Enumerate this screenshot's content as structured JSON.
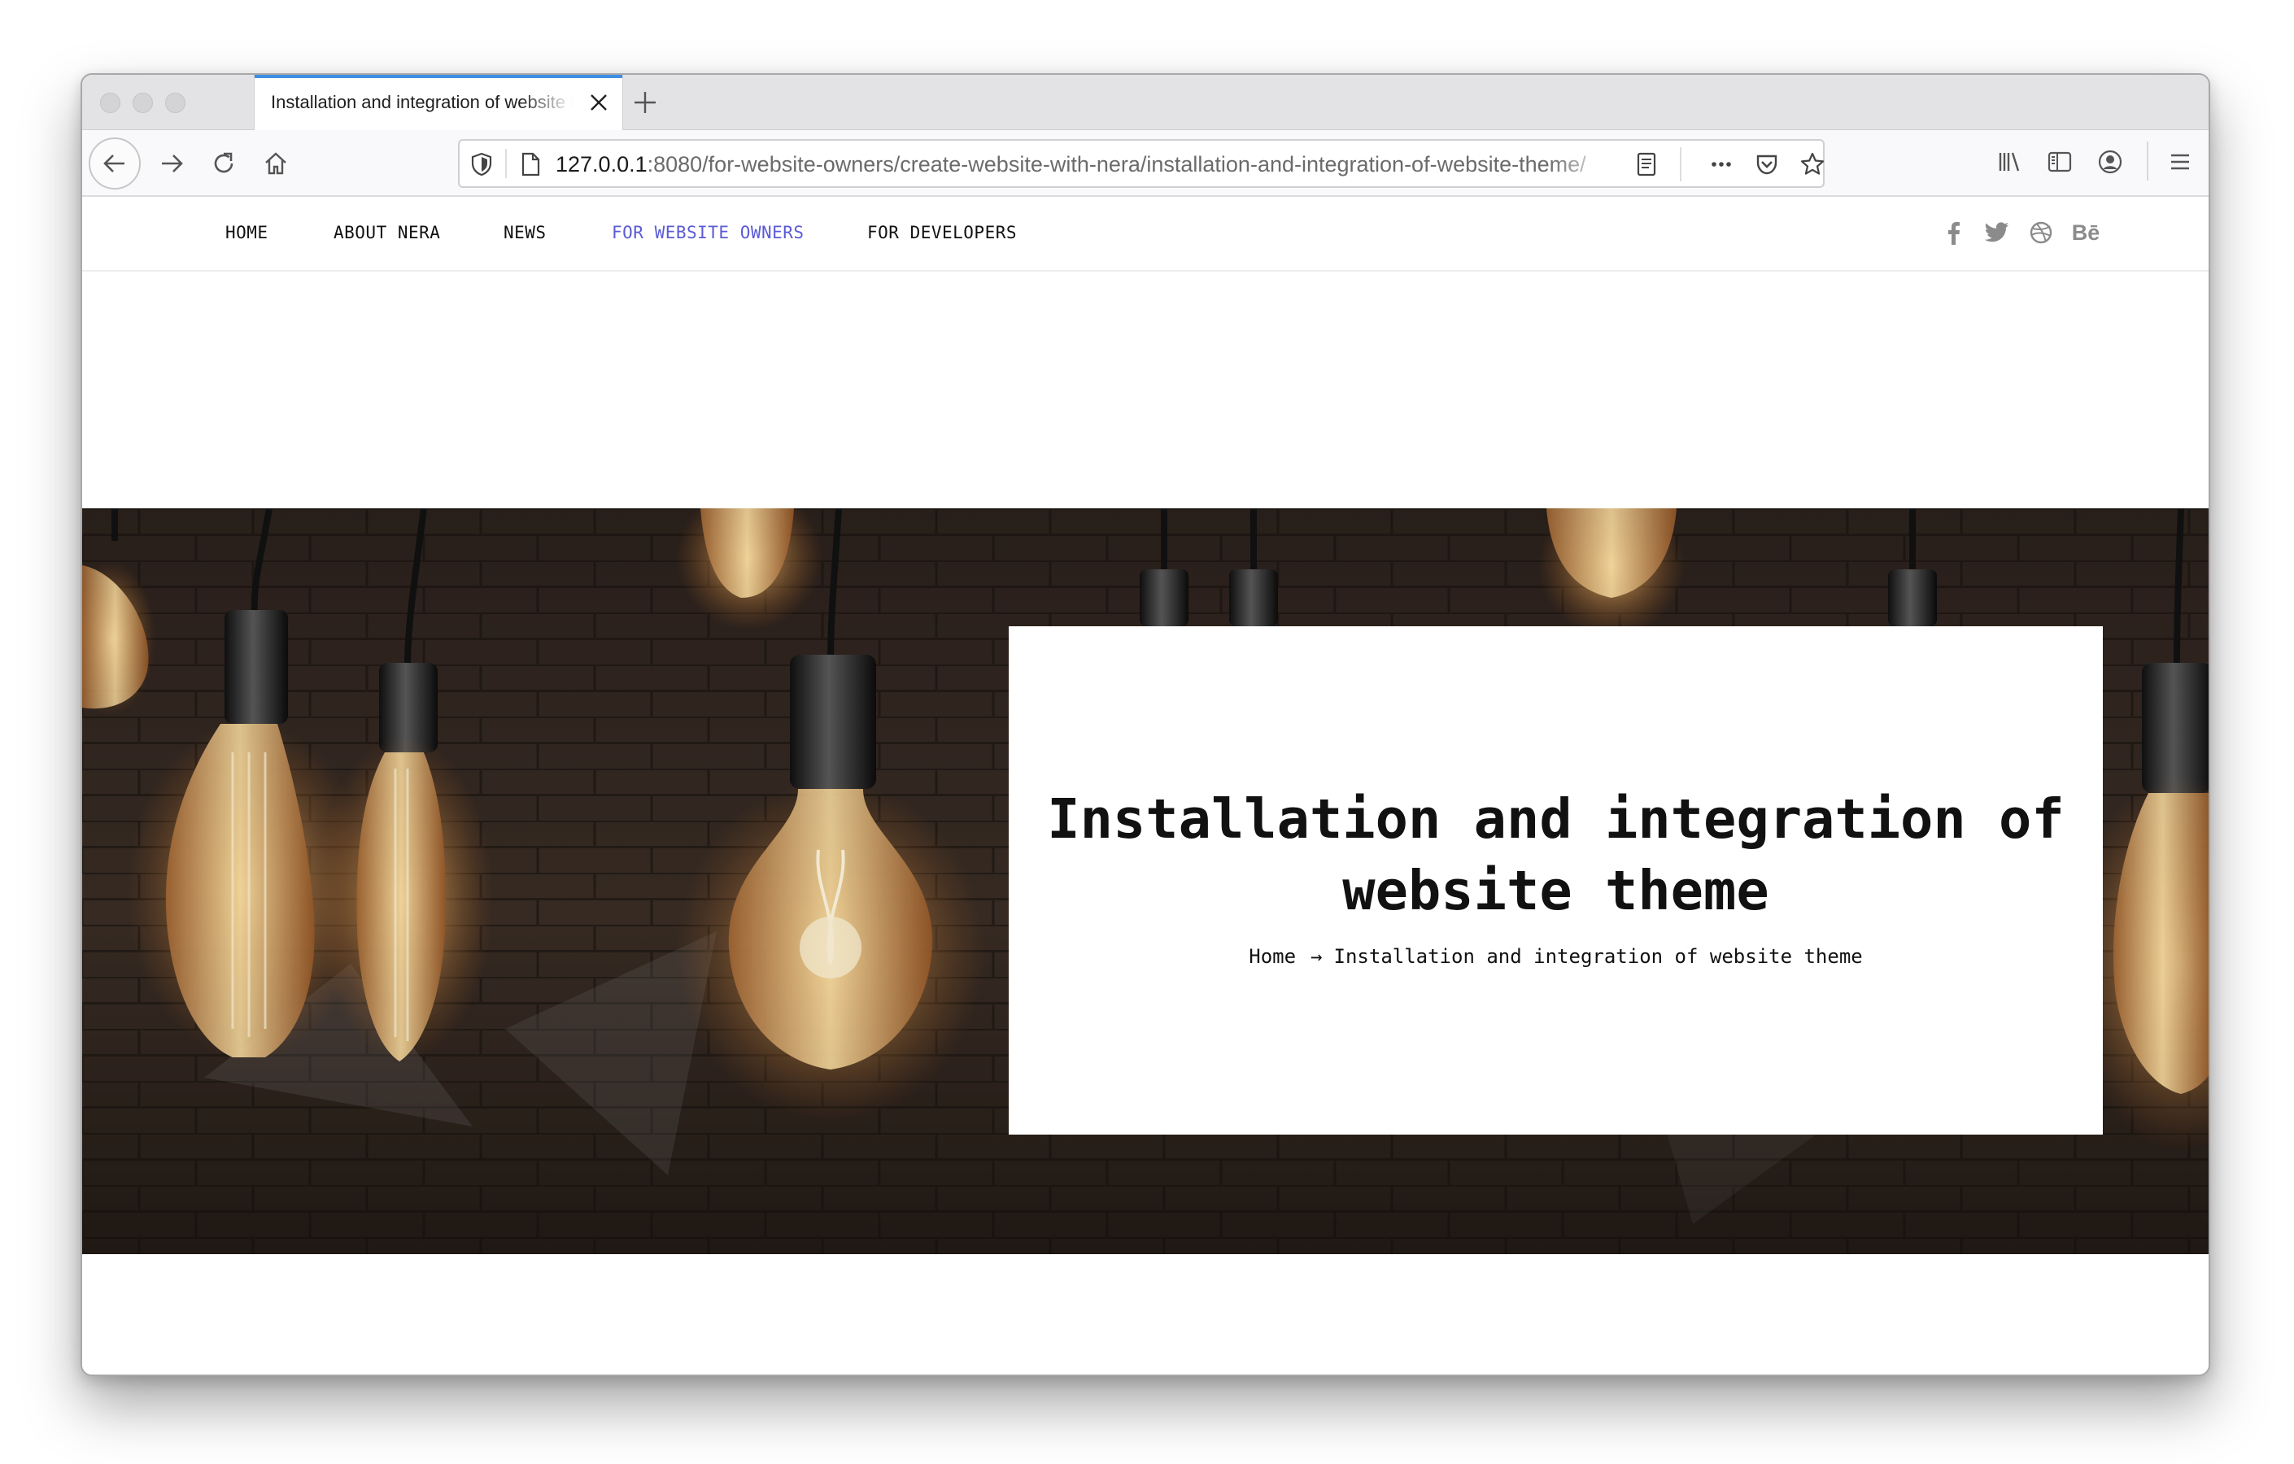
{
  "browser": {
    "tab_title": "Installation and integration of website theme",
    "url_host": "127.0.0.1",
    "url_rest": ":8080/for-website-owners/create-website-with-nera/installation-and-integration-of-website-theme/"
  },
  "site": {
    "menu": [
      {
        "label": "HOME",
        "active": false
      },
      {
        "label": "ABOUT NERA",
        "active": false
      },
      {
        "label": "NEWS",
        "active": false
      },
      {
        "label": "FOR WEBSITE OWNERS",
        "active": true
      },
      {
        "label": "FOR DEVELOPERS",
        "active": false
      }
    ],
    "social": [
      "facebook-icon",
      "twitter-icon",
      "dribbble-icon",
      "behance-icon"
    ],
    "behance_label": "Bē",
    "accent_color": "#5b5bd6"
  },
  "hero": {
    "title": "Installation and integration of website theme",
    "breadcrumb": {
      "home": "Home",
      "arrow": "→",
      "current": "Installation and integration of website theme"
    }
  }
}
